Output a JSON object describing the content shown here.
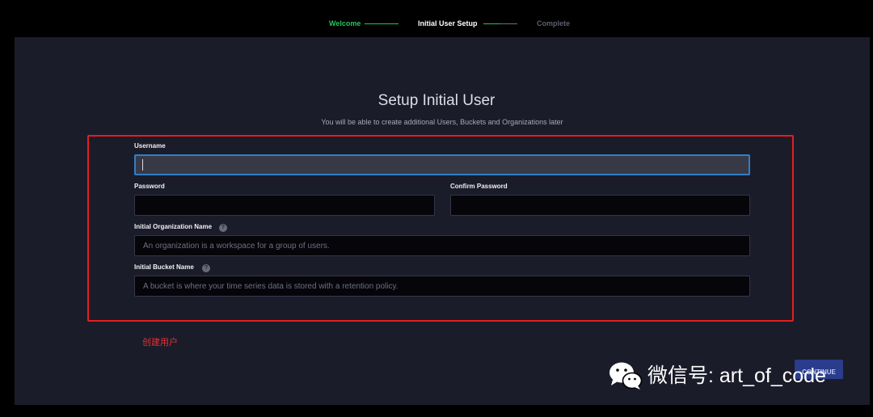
{
  "stepper": {
    "steps": [
      {
        "label": "Welcome",
        "status": "done"
      },
      {
        "label": "Initial User Setup",
        "status": "current"
      },
      {
        "label": "Complete",
        "status": "pending"
      }
    ]
  },
  "form": {
    "title": "Setup Initial User",
    "subtitle": "You will be able to create additional Users, Buckets and Organizations later",
    "username": {
      "label": "Username",
      "value": ""
    },
    "password": {
      "label": "Password",
      "value": ""
    },
    "confirm_password": {
      "label": "Confirm Password",
      "value": ""
    },
    "org": {
      "label": "Initial Organization Name",
      "placeholder": "An organization is a workspace for a group of users."
    },
    "bucket": {
      "label": "Initial Bucket Name",
      "placeholder": "A bucket is where your time series data is stored with a retention policy."
    },
    "help_glyph": "?"
  },
  "annotation": {
    "text": "创建用户",
    "color": "#e41e1e"
  },
  "continue_button": {
    "label": "CONTINUE"
  },
  "watermark": {
    "text": "微信号: art_of_code"
  },
  "colors": {
    "accent_green": "#22c55e",
    "focus_blue": "#2f80c4",
    "panel_bg": "#1b1c2a",
    "button_bg": "#2a3c8c"
  }
}
